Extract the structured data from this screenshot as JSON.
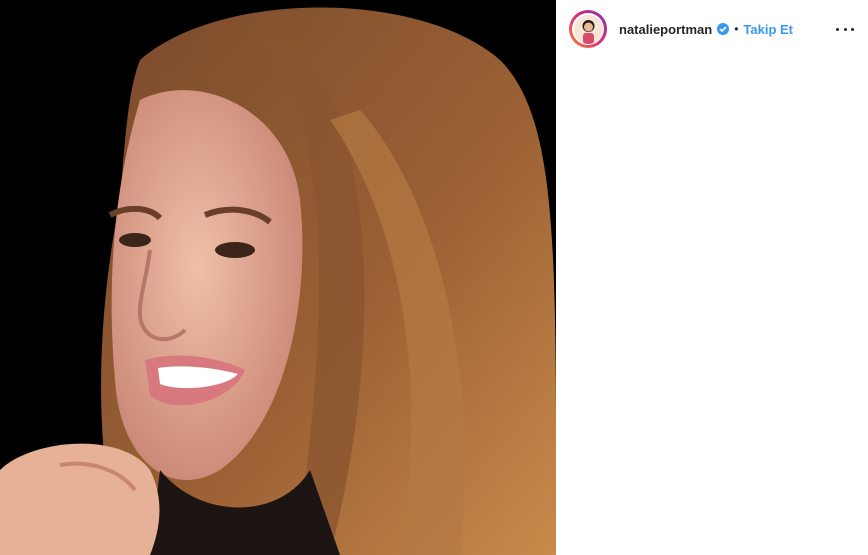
{
  "post": {
    "username": "natalieportman",
    "follow_label": "Takip Et",
    "separator": "•",
    "verified": true
  },
  "colors": {
    "accent": "#3897f0",
    "text": "#262626",
    "media_background": "#000000"
  },
  "icons": {
    "verified": "verified-badge-icon",
    "more": "more-options-icon"
  }
}
